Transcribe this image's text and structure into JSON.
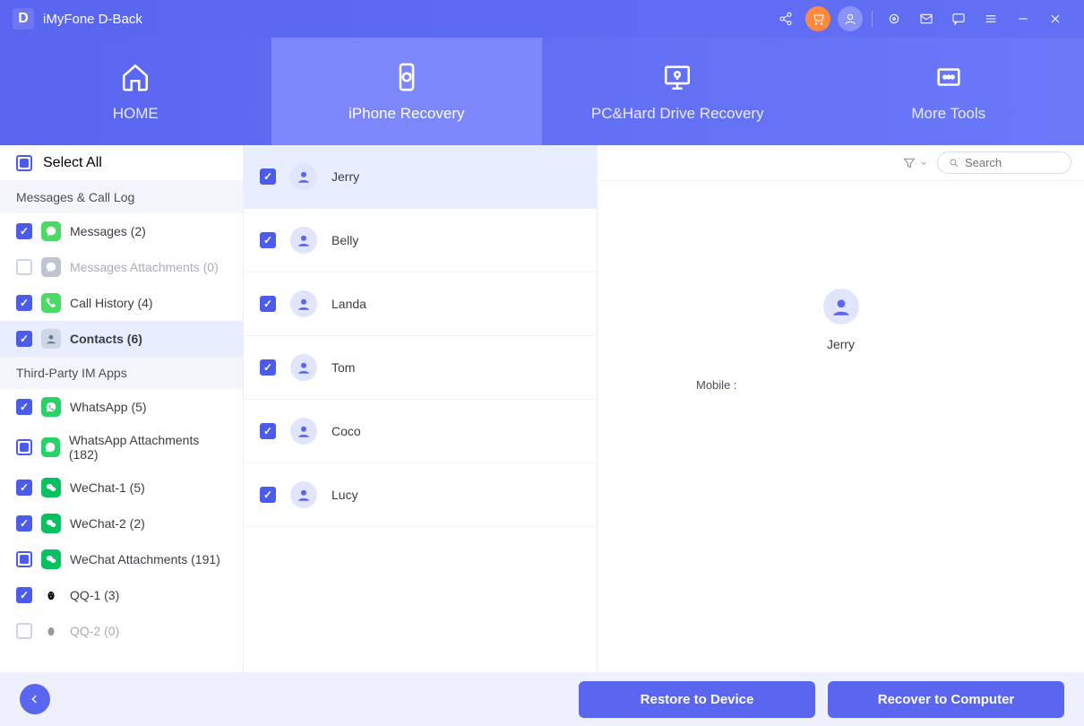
{
  "app": {
    "title": "iMyFone D-Back",
    "logo_letter": "D"
  },
  "nav": {
    "items": [
      {
        "key": "home",
        "label": "HOME"
      },
      {
        "key": "iphone",
        "label": "iPhone Recovery"
      },
      {
        "key": "pc",
        "label": "PC&Hard Drive Recovery"
      },
      {
        "key": "tools",
        "label": "More Tools"
      }
    ],
    "active": "iphone"
  },
  "sidebar": {
    "select_all_label": "Select All",
    "section1_label": "Messages & Call Log",
    "section2_label": "Third-Party IM Apps",
    "items": {
      "messages": "Messages (2)",
      "msg_att": "Messages Attachments (0)",
      "call_hist": "Call History (4)",
      "contacts": "Contacts (6)",
      "whatsapp": "WhatsApp (5)",
      "wa_att": "WhatsApp Attachments (182)",
      "wechat1": "WeChat-1 (5)",
      "wechat2": "WeChat-2 (2)",
      "wc_att": "WeChat Attachments (191)",
      "qq1": "QQ-1 (3)",
      "qq2": "QQ-2 (0)"
    }
  },
  "toolbar": {
    "search_placeholder": "Search"
  },
  "contacts": [
    {
      "name": "Jerry"
    },
    {
      "name": "Belly"
    },
    {
      "name": "Landa"
    },
    {
      "name": "Tom"
    },
    {
      "name": "Coco"
    },
    {
      "name": "Lucy"
    }
  ],
  "detail": {
    "name": "Jerry",
    "mobile_label": "Mobile :"
  },
  "footer": {
    "restore_label": "Restore to Device",
    "recover_label": "Recover to Computer"
  }
}
